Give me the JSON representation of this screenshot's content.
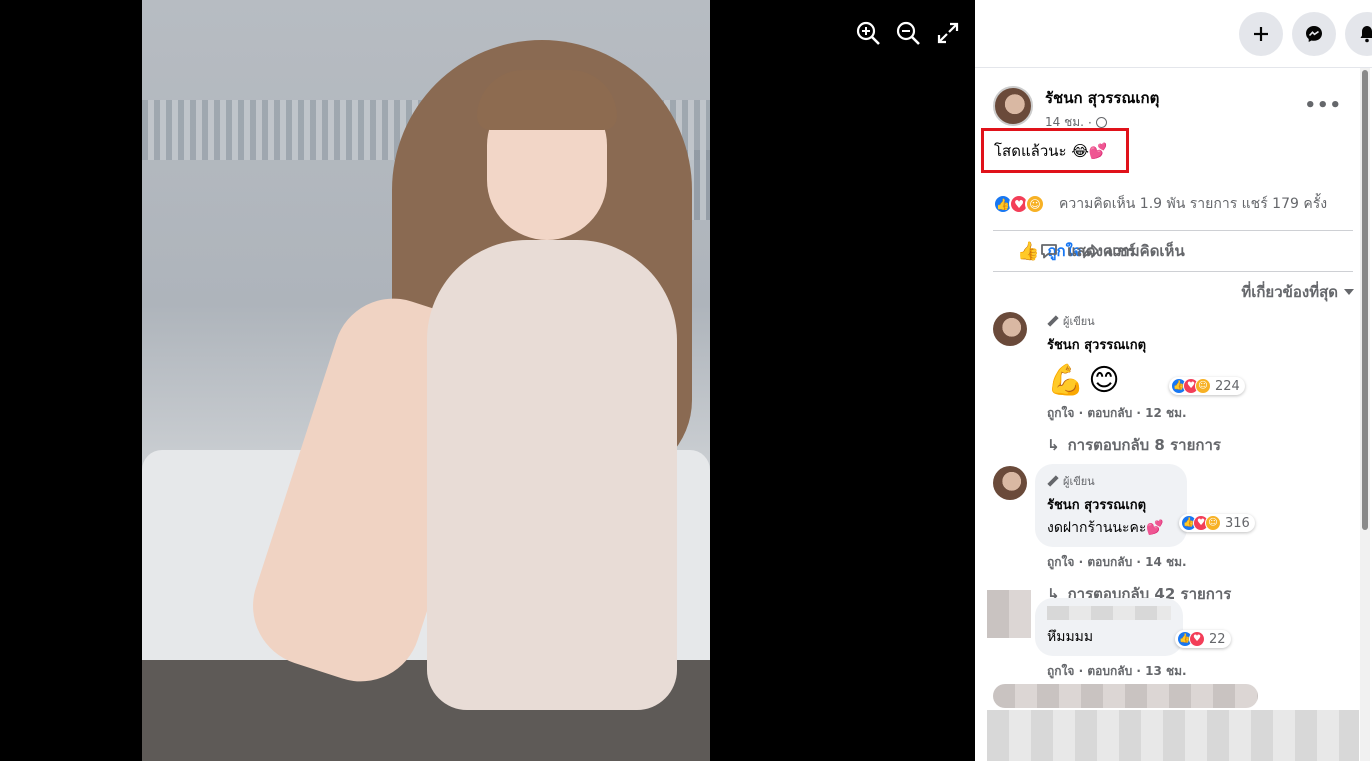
{
  "viewer": {
    "controls": {
      "zoom_in_icon": "zoom-in-icon",
      "zoom_out_icon": "zoom-out-icon",
      "fullscreen_icon": "fullscreen-icon"
    }
  },
  "topbar": {
    "create_icon": "plus-icon",
    "messenger_icon": "messenger-icon",
    "notifications_icon": "bell-icon"
  },
  "post": {
    "author": "รัชนก สุวรรณเกตุ",
    "time": "14 ชม.",
    "text": "โสดแล้วนะ 😂💕",
    "more": "•••",
    "stats": "ความคิดเห็น 1.9 พัน รายการ  แชร์ 179 ครั้ง"
  },
  "actions": {
    "like": "ถูกใจ",
    "comment": "แสดงความคิดเห็น",
    "share": "แชร์"
  },
  "filter": {
    "label": "ที่เกี่ยวข้องที่สุด"
  },
  "comments": [
    {
      "tag": "ผู้เขียน",
      "name": "รัชนก สุวรรณเกตุ",
      "emoji": "💪😊",
      "reactions": "224",
      "meta": "ถูกใจ · ตอบกลับ · 12 ชม.",
      "replies": "การตอบกลับ 8 รายการ"
    },
    {
      "tag": "ผู้เขียน",
      "name": "รัชนก สุวรรณเกตุ",
      "text": "งดฝากร้านนะคะ💕",
      "reactions": "316",
      "meta": "ถูกใจ · ตอบกลับ · 14 ชม.",
      "replies": "การตอบกลับ 42 รายการ"
    },
    {
      "text": "หึมมมม",
      "reactions": "22",
      "meta": "ถูกใจ · ตอบกลับ · 13 ชม."
    }
  ],
  "colors": {
    "accent": "#1877f2",
    "highlight_border": "#e0121a"
  }
}
